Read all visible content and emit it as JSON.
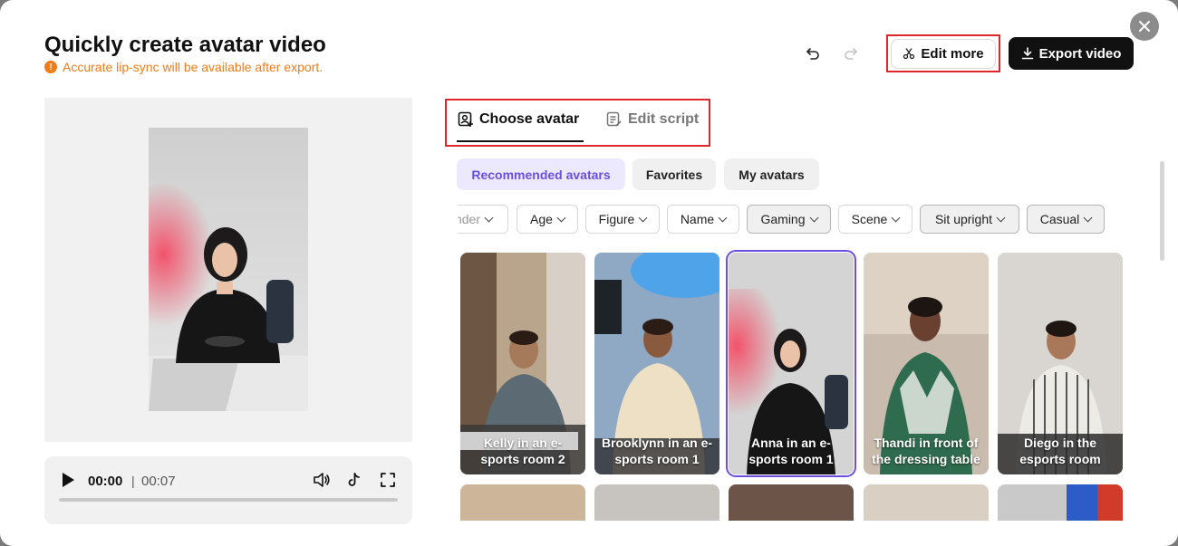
{
  "header": {
    "title": "Quickly create avatar video",
    "subtitle": "Accurate lip-sync will be available after export.",
    "warn_glyph": "!",
    "edit_more": "Edit more",
    "export": "Export video"
  },
  "tabs": [
    {
      "label": "Choose avatar",
      "active": true
    },
    {
      "label": "Edit script",
      "active": false
    }
  ],
  "segments": [
    {
      "label": "Recommended avatars",
      "active": true
    },
    {
      "label": "Favorites",
      "active": false
    },
    {
      "label": "My avatars",
      "active": false
    }
  ],
  "filters": [
    "nder",
    "Age",
    "Figure",
    "Name",
    "Gaming",
    "Scene",
    "Sit upright",
    "Casual"
  ],
  "selected_filters": [
    "Gaming",
    "Sit upright",
    "Casual"
  ],
  "avatars": [
    {
      "label": "Kelly in an e-sports room 2",
      "selected": false
    },
    {
      "label": "Brooklynn in an e-sports room 1",
      "selected": false
    },
    {
      "label": "Anna in an e-sports room 1",
      "selected": true
    },
    {
      "label": "Thandi in front of the dressing table",
      "selected": false
    },
    {
      "label": "Diego in the esports room",
      "selected": false
    }
  ],
  "player": {
    "current": "00:00",
    "separator": "|",
    "total": "00:07",
    "progress": 0
  },
  "colors": {
    "accent": "#6a4fe0",
    "warning": "#f07c1a",
    "highlight_box": "#e0262b"
  }
}
